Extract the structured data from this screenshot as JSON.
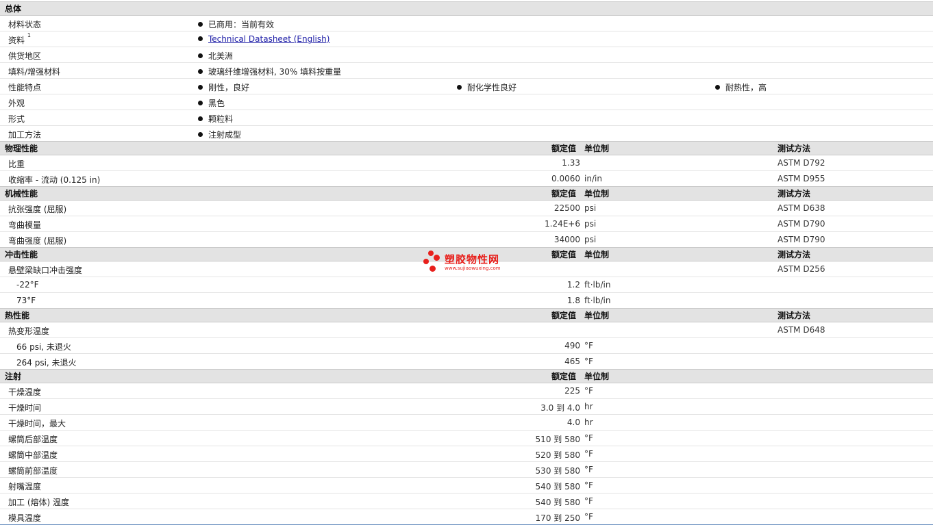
{
  "general": {
    "title": "总体",
    "status_label": "材料状态",
    "status_value": "已商用：当前有效",
    "docs_label": "资料",
    "docs_sup": "1",
    "docs_link": "Technical Datasheet (English)",
    "region_label": "供货地区",
    "region_value": "北美洲",
    "filler_label": "填料/增强材料",
    "filler_value": "玻璃纤维增强材料, 30% 填料按重量",
    "features_label": "性能特点",
    "features": [
      "刚性，良好",
      "耐化学性良好",
      "耐热性，高"
    ],
    "appearance_label": "外观",
    "appearance_value": "黑色",
    "form_label": "形式",
    "form_value": "颗粒料",
    "process_label": "加工方法",
    "process_value": "注射成型"
  },
  "columns": {
    "nominal": "额定值",
    "unit": "单位制",
    "test": "测试方法"
  },
  "sections": {
    "physical": {
      "title": "物理性能",
      "rows": [
        {
          "label": "比重",
          "value": "1.33",
          "unit": "",
          "test": "ASTM D792"
        },
        {
          "label": "收缩率 - 流动 (0.125 in)",
          "value": "0.0060",
          "unit": "in/in",
          "test": "ASTM D955"
        }
      ]
    },
    "mechanical": {
      "title": "机械性能",
      "rows": [
        {
          "label": "抗张强度 (屈服)",
          "value": "22500",
          "unit": "psi",
          "test": "ASTM D638"
        },
        {
          "label": "弯曲模量",
          "value": "1.24E+6",
          "unit": "psi",
          "test": "ASTM D790"
        },
        {
          "label": "弯曲强度 (屈服)",
          "value": "34000",
          "unit": "psi",
          "test": "ASTM D790"
        }
      ]
    },
    "impact": {
      "title": "冲击性能",
      "rows": [
        {
          "label": "悬壁梁缺口冲击强度",
          "value": "",
          "unit": "",
          "test": "ASTM D256"
        },
        {
          "label": "-22°F",
          "value": "1.2",
          "unit": "ft·lb/in",
          "test": ""
        },
        {
          "label": "73°F",
          "value": "1.8",
          "unit": "ft·lb/in",
          "test": ""
        }
      ]
    },
    "thermal": {
      "title": "热性能",
      "rows": [
        {
          "label": "热变形温度",
          "value": "",
          "unit": "",
          "test": "ASTM D648"
        },
        {
          "label": "66 psi, 未退火",
          "value": "490",
          "unit": "°F",
          "test": ""
        },
        {
          "label": "264 psi, 未退火",
          "value": "465",
          "unit": "°F",
          "test": ""
        }
      ]
    },
    "injection": {
      "title": "注射",
      "rows": [
        {
          "label": "干燥温度",
          "value": "225",
          "unit": "°F"
        },
        {
          "label": "干燥时间",
          "value": "3.0 到  4.0",
          "unit": "hr"
        },
        {
          "label": "干燥时间，最大",
          "value": "4.0",
          "unit": "hr"
        },
        {
          "label": "螺筒后部温度",
          "value": "510 到  580",
          "unit": "°F"
        },
        {
          "label": "螺筒中部温度",
          "value": "520 到  580",
          "unit": "°F"
        },
        {
          "label": "螺筒前部温度",
          "value": "530 到  580",
          "unit": "°F"
        },
        {
          "label": "射嘴温度",
          "value": "540 到  580",
          "unit": "°F"
        },
        {
          "label": "加工 (熔体) 温度",
          "value": "540 到  580",
          "unit": "°F"
        },
        {
          "label": "模具温度",
          "value": "170 到  250",
          "unit": "°F"
        }
      ]
    }
  },
  "watermark": {
    "name": "塑胶物性网",
    "url": "www.sujiaowuxing.com",
    "color": "#e8201c"
  }
}
